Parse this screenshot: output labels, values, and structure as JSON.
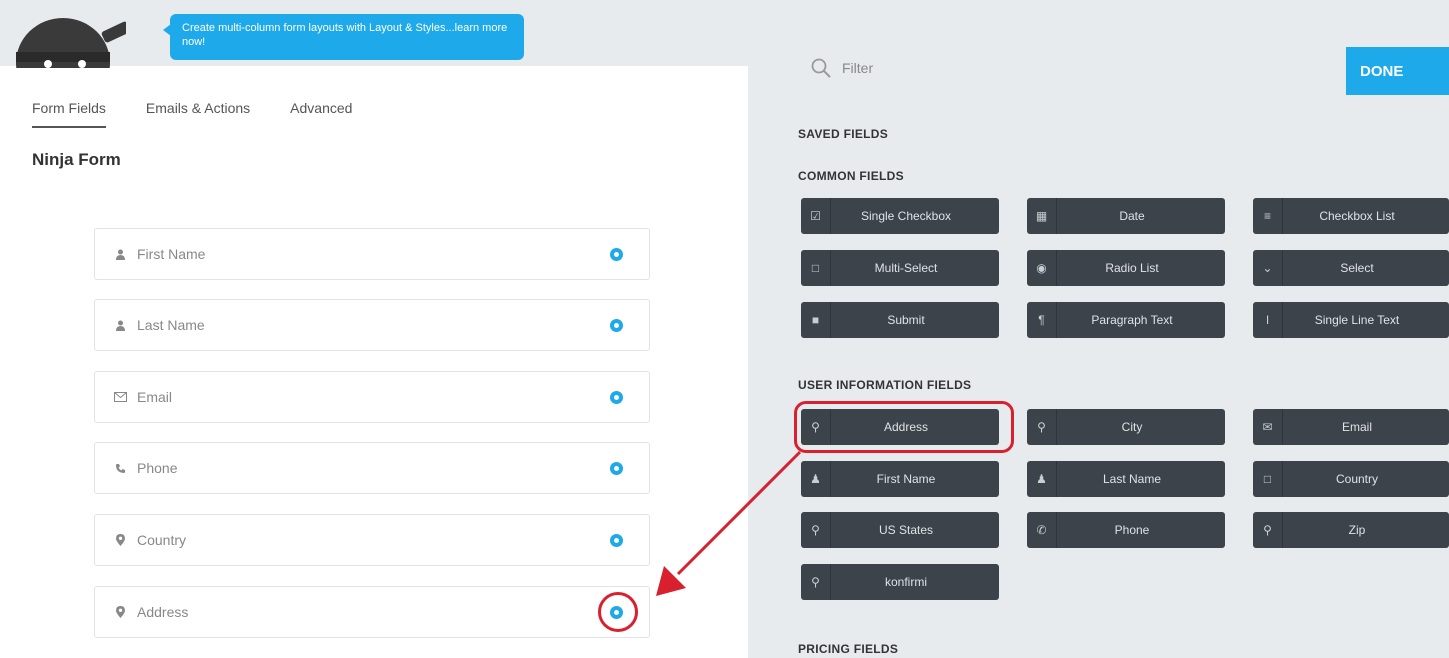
{
  "tooltip": {
    "text": "Create multi-column form layouts with Layout & Styles...learn more now!"
  },
  "tabs": [
    {
      "label": "Form Fields"
    },
    {
      "label": "Emails & Actions"
    },
    {
      "label": "Advanced"
    }
  ],
  "form": {
    "title": "Ninja Form",
    "fields": [
      {
        "label": "First Name",
        "icon": "user-icon"
      },
      {
        "label": "Last Name",
        "icon": "user-icon"
      },
      {
        "label": "Email",
        "icon": "envelope-icon"
      },
      {
        "label": "Phone",
        "icon": "phone-icon"
      },
      {
        "label": "Country",
        "icon": "map-marker-icon"
      },
      {
        "label": "Address",
        "icon": "map-marker-icon"
      }
    ]
  },
  "panel": {
    "filter_placeholder": "Filter",
    "done_label": "DONE",
    "saved_title": "SAVED FIELDS",
    "common_title": "COMMON FIELDS",
    "user_title": "USER INFORMATION FIELDS",
    "pricing_title": "PRICING FIELDS",
    "common_fields": [
      {
        "label": "Single Checkbox",
        "icon": "check-square-icon"
      },
      {
        "label": "Date",
        "icon": "calendar-icon"
      },
      {
        "label": "Checkbox List",
        "icon": "list-icon"
      },
      {
        "label": "Multi-Select",
        "icon": "square-icon"
      },
      {
        "label": "Radio List",
        "icon": "dot-circle-icon"
      },
      {
        "label": "Select",
        "icon": "chevron-down-icon"
      },
      {
        "label": "Submit",
        "icon": "square-filled-icon"
      },
      {
        "label": "Paragraph Text",
        "icon": "paragraph-icon"
      },
      {
        "label": "Single Line Text",
        "icon": "text-cursor-icon"
      }
    ],
    "user_fields": [
      {
        "label": "Address",
        "icon": "map-marker-icon"
      },
      {
        "label": "City",
        "icon": "map-marker-icon"
      },
      {
        "label": "Email",
        "icon": "envelope-icon"
      },
      {
        "label": "First Name",
        "icon": "user-icon"
      },
      {
        "label": "Last Name",
        "icon": "user-icon"
      },
      {
        "label": "Country",
        "icon": "square-icon"
      },
      {
        "label": "US States",
        "icon": "map-marker-icon"
      },
      {
        "label": "Phone",
        "icon": "phone-icon"
      },
      {
        "label": "Zip",
        "icon": "map-marker-icon"
      },
      {
        "label": "konfirmi",
        "icon": "map-marker-icon"
      }
    ]
  },
  "colors": {
    "accent": "#1ea9ea",
    "button_dark": "#3d434a",
    "highlight_red": "#d9202e",
    "panel_bg": "#e8ebee"
  }
}
